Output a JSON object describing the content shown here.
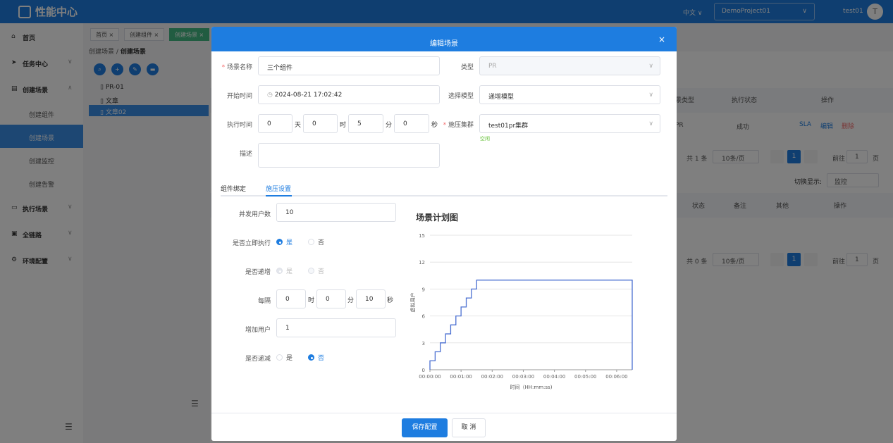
{
  "app": {
    "title": "性能中心",
    "language": "中文",
    "project": "DemoProject01",
    "user": "test01",
    "avatar_letter": "T"
  },
  "sidebar": {
    "items": [
      {
        "label": "首页",
        "icon": "home-icon"
      },
      {
        "label": "任务中心",
        "icon": "send-icon"
      },
      {
        "label": "创建场景",
        "icon": "document-icon"
      },
      {
        "label": "执行场景",
        "icon": "monitor-icon"
      },
      {
        "label": "全链路",
        "icon": "link-icon"
      },
      {
        "label": "环境配置",
        "icon": "gear-icon"
      }
    ],
    "subitems": [
      "创建组件",
      "创建场景",
      "创建监控",
      "创建告警"
    ],
    "active_sub": "创建场景"
  },
  "tags": [
    {
      "label": "首页 ×"
    },
    {
      "label": "创建组件 ×"
    },
    {
      "label": "创建场景 ×"
    }
  ],
  "breadcrumb": {
    "parent": "创建场景",
    "sep": "/",
    "current": "创建场景"
  },
  "tree": [
    "PR-01",
    "文章",
    "文章02"
  ],
  "background": {
    "col_type": "景类型",
    "col_exec_state": "执行状态",
    "col_ops": "操作",
    "row_type": "PR",
    "row_state": "成功",
    "op_sla": "SLA",
    "op_edit": "编辑",
    "op_delete": "删除",
    "pager1": {
      "total": "共 1 条",
      "size": "10条/页",
      "page": "1",
      "goto": "前往",
      "goto_val": "1",
      "unit": "页"
    },
    "switch_label": "切换显示:",
    "switch_value": "监控",
    "col_state": "状态",
    "col_note": "备注",
    "col_other": "其他",
    "col_ops2": "操作",
    "pager2": {
      "total": "共 0 条",
      "size": "10条/页",
      "page": "1",
      "goto": "前往",
      "goto_val": "1",
      "unit": "页"
    }
  },
  "modal": {
    "title": "编辑场景",
    "close": "×",
    "name_label": "场景名称",
    "name_value": "三个组件",
    "type_label": "类型",
    "type_value": "PR",
    "start_label": "开始时间",
    "start_value": "2024-08-21 17:02:42",
    "model_label": "选择模型",
    "model_value": "递增模型",
    "exec_label": "执行时间",
    "exec": {
      "days": "0",
      "days_unit": "天",
      "hours": "0",
      "hours_unit": "时",
      "minutes": "5",
      "minutes_unit": "分",
      "seconds": "0",
      "seconds_unit": "秒"
    },
    "cluster_label": "施压集群",
    "cluster_value": "test01pr集群",
    "cluster_state": "空闲",
    "desc_label": "描述",
    "desc_value": "",
    "tabs": [
      "组件绑定",
      "施压设置"
    ],
    "active_tab": "施压设置",
    "users_label": "并发用户数",
    "users_value": "10",
    "immediate_label": "是否立即执行",
    "yes": "是",
    "no": "否",
    "increase_label": "是否递增",
    "every_label": "每隔",
    "every": {
      "hours": "0",
      "hours_unit": "时",
      "minutes": "0",
      "minutes_unit": "分",
      "seconds": "10",
      "seconds_unit": "秒"
    },
    "add_users_label": "增加用户",
    "add_users_value": "1",
    "decrease_label": "是否递减",
    "save": "保存配置",
    "cancel": "取 消"
  },
  "chart_data": {
    "type": "line",
    "title": "场景计划图",
    "xlabel": "时间（HH:mm:ss)",
    "ylabel": "虚拟用户",
    "x_ticks": [
      "00:00:00",
      "00:01:00",
      "00:02:00",
      "00:03:00",
      "00:04:00",
      "00:05:00",
      "00:06:00"
    ],
    "y_ticks": [
      0,
      3,
      6,
      9,
      12,
      15
    ],
    "ylim": [
      0,
      15
    ],
    "xlim_seconds": [
      0,
      390
    ],
    "series": [
      {
        "step": true,
        "x_seconds": [
          0,
          10,
          20,
          30,
          40,
          50,
          60,
          70,
          80,
          90,
          100,
          390,
          390
        ],
        "values": [
          1,
          2,
          3,
          4,
          5,
          6,
          7,
          8,
          9,
          10,
          10,
          10,
          0
        ]
      }
    ],
    "line_color": "#4a6fd1",
    "grid": true
  }
}
